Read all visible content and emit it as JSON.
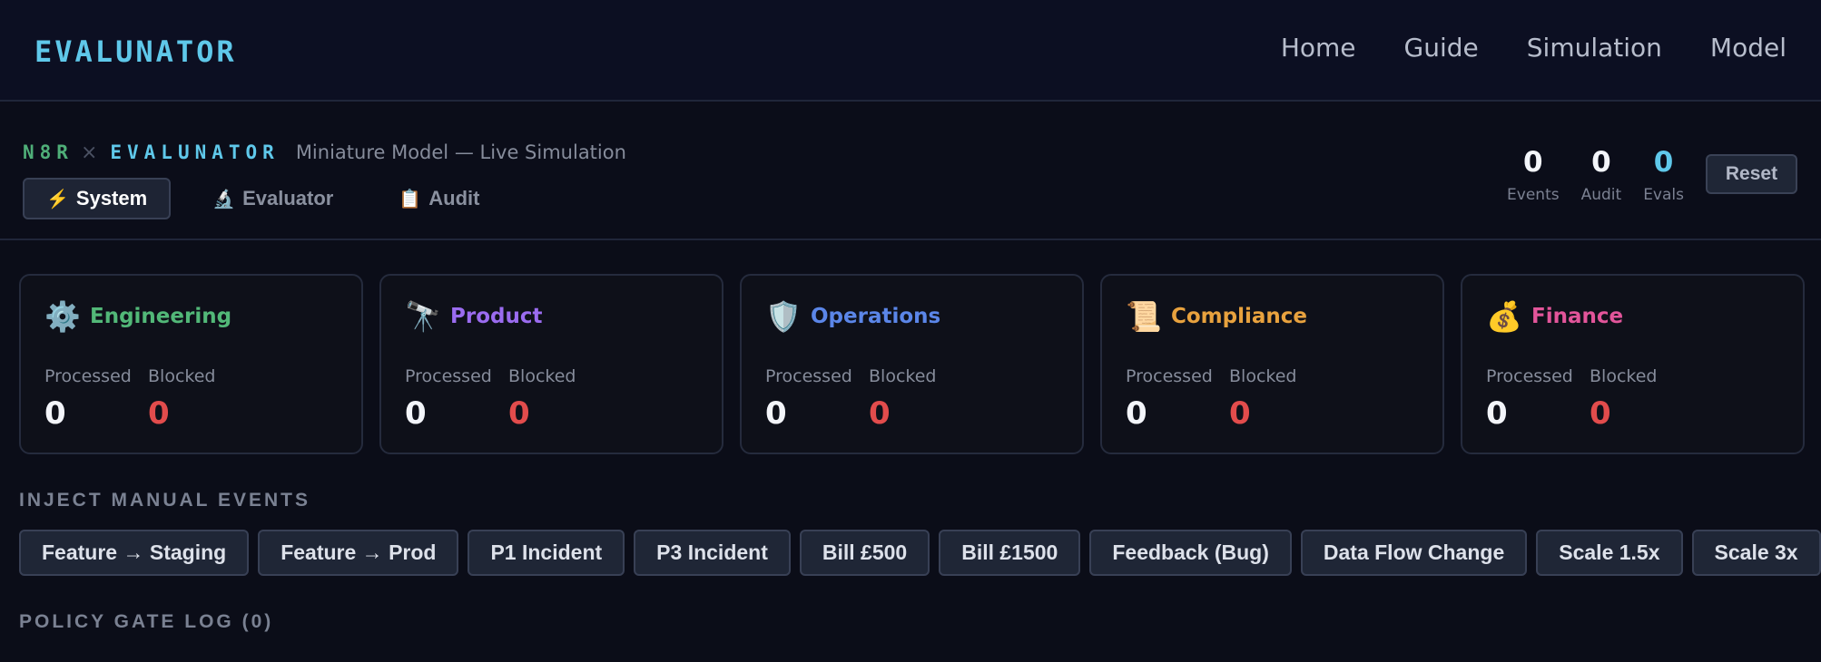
{
  "nav": {
    "brand": "EVALUNATOR",
    "links": [
      "Home",
      "Guide",
      "Simulation",
      "Model"
    ]
  },
  "header": {
    "tag_left": "N8R",
    "separator": "×",
    "tag_right": "EVALUNATOR",
    "subtitle": "Miniature Model — Live Simulation",
    "tabs": [
      {
        "icon": "⚡",
        "label": "System",
        "active": true
      },
      {
        "icon": "🔬",
        "label": "Evaluator",
        "active": false
      },
      {
        "icon": "📋",
        "label": "Audit",
        "active": false
      }
    ],
    "counters": [
      {
        "value": "0",
        "label": "Events"
      },
      {
        "value": "0",
        "label": "Audit"
      },
      {
        "value": "0",
        "label": "Evals"
      }
    ],
    "reset_label": "Reset"
  },
  "departments": [
    {
      "icon": "⚙️",
      "icon_name": "gear-icon",
      "name": "Engineering",
      "color": "#52b878",
      "processed_label": "Processed",
      "processed": "0",
      "blocked_label": "Blocked",
      "blocked": "0"
    },
    {
      "icon": "🔭",
      "icon_name": "telescope-icon",
      "name": "Product",
      "color": "#9b6cf0",
      "processed_label": "Processed",
      "processed": "0",
      "blocked_label": "Blocked",
      "blocked": "0"
    },
    {
      "icon": "🛡️",
      "icon_name": "shield-icon",
      "name": "Operations",
      "color": "#5b86e8",
      "processed_label": "Processed",
      "processed": "0",
      "blocked_label": "Blocked",
      "blocked": "0"
    },
    {
      "icon": "📜",
      "icon_name": "scroll-icon",
      "name": "Compliance",
      "color": "#e8a23e",
      "processed_label": "Processed",
      "processed": "0",
      "blocked_label": "Blocked",
      "blocked": "0"
    },
    {
      "icon": "💰",
      "icon_name": "money-bag-icon",
      "name": "Finance",
      "color": "#e2559a",
      "processed_label": "Processed",
      "processed": "0",
      "blocked_label": "Blocked",
      "blocked": "0"
    }
  ],
  "colors": {
    "blocked": "#e24c4c",
    "processed": "#f3f5fa",
    "accent": "#5fc8ea"
  },
  "inject": {
    "title": "INJECT MANUAL EVENTS",
    "buttons": [
      "Feature → Staging",
      "Feature → Prod",
      "P1 Incident",
      "P3 Incident",
      "Bill £500",
      "Bill £1500",
      "Feedback (Bug)",
      "Data Flow Change",
      "Scale 1.5x",
      "Scale 3x"
    ]
  },
  "policy_log": {
    "title": "POLICY GATE LOG (0)"
  }
}
